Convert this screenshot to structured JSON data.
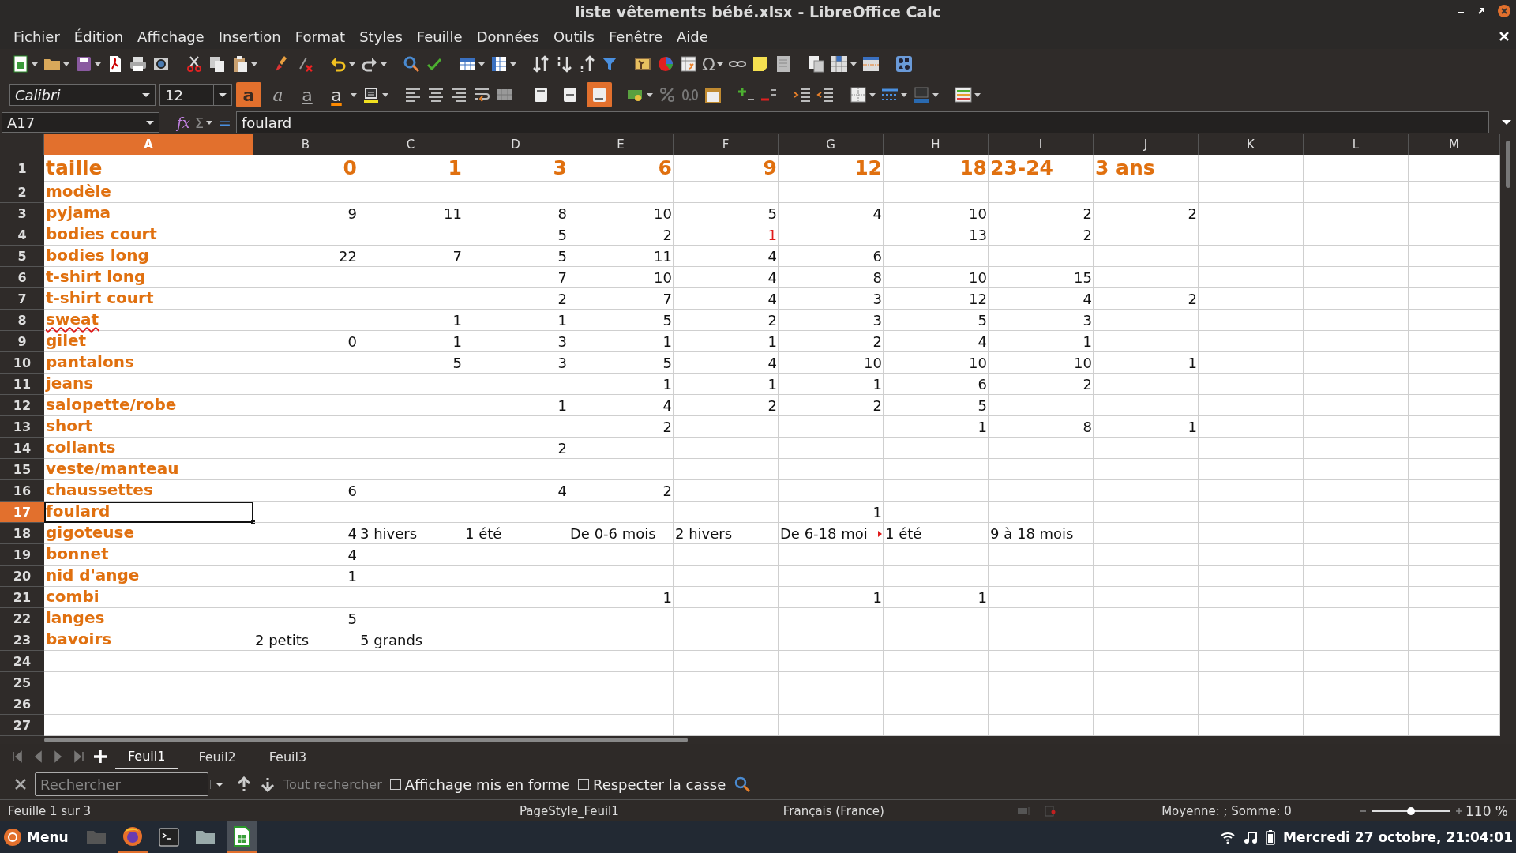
{
  "window": {
    "title": "liste vêtements bébé.xlsx - LibreOffice Calc"
  },
  "menu_bar": [
    "Fichier",
    "Édition",
    "Affichage",
    "Insertion",
    "Format",
    "Styles",
    "Feuille",
    "Données",
    "Outils",
    "Fenêtre",
    "Aide"
  ],
  "standard_toolbar": {
    "special_character_glyph": "Ω"
  },
  "formatting_toolbar": {
    "font_name": "Calibri",
    "font_size": "12",
    "text_buttons": [
      {
        "kind": "bold",
        "glyph": "a",
        "on": true
      },
      {
        "kind": "italic",
        "glyph": "a",
        "on": false
      },
      {
        "kind": "underline",
        "glyph": "a",
        "on": false
      },
      {
        "kind": "font_color",
        "glyph": "a",
        "on": false
      }
    ],
    "vertical_align": [
      {
        "kind": "top",
        "on": false
      },
      {
        "kind": "center",
        "on": false
      },
      {
        "kind": "bottom",
        "on": true
      }
    ]
  },
  "formula_bar": {
    "name_box": "A17",
    "wizard_glyph": "fx",
    "sum_glyph": "Σ",
    "equals_glyph": "=",
    "content": "foulard"
  },
  "sheet": {
    "columns": [
      {
        "label": "A",
        "selected": true
      },
      {
        "label": "B",
        "selected": false
      },
      {
        "label": "C",
        "selected": false
      },
      {
        "label": "D",
        "selected": false
      },
      {
        "label": "E",
        "selected": false
      },
      {
        "label": "F",
        "selected": false
      },
      {
        "label": "G",
        "selected": false
      },
      {
        "label": "H",
        "selected": false
      },
      {
        "label": "I",
        "selected": false
      },
      {
        "label": "J",
        "selected": false
      },
      {
        "label": "K",
        "selected": false
      },
      {
        "label": "L",
        "selected": false
      },
      {
        "label": "M",
        "selected": false
      }
    ],
    "rows": [
      {
        "label": "1",
        "selected": false,
        "kind": "heading",
        "cells": [
          {
            "text": "taille",
            "kind": "text"
          },
          {
            "text": "0",
            "kind": "number"
          },
          {
            "text": "1",
            "kind": "number"
          },
          {
            "text": "3",
            "kind": "number"
          },
          {
            "text": "6",
            "kind": "number"
          },
          {
            "text": "9",
            "kind": "number"
          },
          {
            "text": "12",
            "kind": "number"
          },
          {
            "text": "18",
            "kind": "number"
          },
          {
            "text": "23-24",
            "kind": "text"
          },
          {
            "text": "3 ans",
            "kind": "text"
          }
        ]
      },
      {
        "label": "2",
        "selected": false,
        "kind": "data",
        "cells": [
          {
            "text": "modèle",
            "kind": "text"
          }
        ]
      },
      {
        "label": "3",
        "selected": false,
        "kind": "data",
        "cells": [
          {
            "text": "pyjama",
            "kind": "text"
          },
          {
            "text": "9",
            "kind": "number"
          },
          {
            "text": "11",
            "kind": "number"
          },
          {
            "text": "8",
            "kind": "number"
          },
          {
            "text": "10",
            "kind": "number"
          },
          {
            "text": "5",
            "kind": "number"
          },
          {
            "text": "4",
            "kind": "number"
          },
          {
            "text": "10",
            "kind": "number"
          },
          {
            "text": "2",
            "kind": "number"
          },
          {
            "text": "2",
            "kind": "number"
          }
        ]
      },
      {
        "label": "4",
        "selected": false,
        "kind": "data",
        "cells": [
          {
            "text": "bodies court",
            "kind": "text"
          },
          null,
          null,
          {
            "text": "5",
            "kind": "number"
          },
          {
            "text": "2",
            "kind": "number"
          },
          {
            "text": "1",
            "kind": "number",
            "color": "#e01b1b"
          },
          null,
          {
            "text": "13",
            "kind": "number"
          },
          {
            "text": "2",
            "kind": "number"
          }
        ]
      },
      {
        "label": "5",
        "selected": false,
        "kind": "data",
        "cells": [
          {
            "text": "bodies long",
            "kind": "text"
          },
          {
            "text": "22",
            "kind": "number"
          },
          {
            "text": "7",
            "kind": "number"
          },
          {
            "text": "5",
            "kind": "number"
          },
          {
            "text": "11",
            "kind": "number"
          },
          {
            "text": "4",
            "kind": "number"
          },
          {
            "text": "6",
            "kind": "number"
          }
        ]
      },
      {
        "label": "6",
        "selected": false,
        "kind": "data",
        "cells": [
          {
            "text": "t-shirt long",
            "kind": "text"
          },
          null,
          null,
          {
            "text": "7",
            "kind": "number"
          },
          {
            "text": "10",
            "kind": "number"
          },
          {
            "text": "4",
            "kind": "number"
          },
          {
            "text": "8",
            "kind": "number"
          },
          {
            "text": "10",
            "kind": "number"
          },
          {
            "text": "15",
            "kind": "number"
          }
        ]
      },
      {
        "label": "7",
        "selected": false,
        "kind": "data",
        "cells": [
          {
            "text": "t-shirt court",
            "kind": "text"
          },
          null,
          null,
          {
            "text": "2",
            "kind": "number"
          },
          {
            "text": "7",
            "kind": "number"
          },
          {
            "text": "4",
            "kind": "number"
          },
          {
            "text": "3",
            "kind": "number"
          },
          {
            "text": "12",
            "kind": "number"
          },
          {
            "text": "4",
            "kind": "number"
          },
          {
            "text": "2",
            "kind": "number"
          }
        ]
      },
      {
        "label": "8",
        "selected": false,
        "kind": "data",
        "cells": [
          {
            "text": "sweat",
            "kind": "text",
            "misspelled": true
          },
          null,
          {
            "text": "1",
            "kind": "number"
          },
          {
            "text": "1",
            "kind": "number"
          },
          {
            "text": "5",
            "kind": "number"
          },
          {
            "text": "2",
            "kind": "number"
          },
          {
            "text": "3",
            "kind": "number"
          },
          {
            "text": "5",
            "kind": "number"
          },
          {
            "text": "3",
            "kind": "number"
          }
        ]
      },
      {
        "label": "9",
        "selected": false,
        "kind": "data",
        "cells": [
          {
            "text": "gilet",
            "kind": "text"
          },
          {
            "text": "0",
            "kind": "number"
          },
          {
            "text": "1",
            "kind": "number"
          },
          {
            "text": "3",
            "kind": "number"
          },
          {
            "text": "1",
            "kind": "number"
          },
          {
            "text": "1",
            "kind": "number"
          },
          {
            "text": "2",
            "kind": "number"
          },
          {
            "text": "4",
            "kind": "number"
          },
          {
            "text": "1",
            "kind": "number"
          }
        ]
      },
      {
        "label": "10",
        "selected": false,
        "kind": "data",
        "cells": [
          {
            "text": "pantalons",
            "kind": "text"
          },
          null,
          {
            "text": "5",
            "kind": "number"
          },
          {
            "text": "3",
            "kind": "number"
          },
          {
            "text": "5",
            "kind": "number"
          },
          {
            "text": "4",
            "kind": "number"
          },
          {
            "text": "10",
            "kind": "number"
          },
          {
            "text": "10",
            "kind": "number"
          },
          {
            "text": "10",
            "kind": "number"
          },
          {
            "text": "1",
            "kind": "number"
          }
        ]
      },
      {
        "label": "11",
        "selected": false,
        "kind": "data",
        "cells": [
          {
            "text": "jeans",
            "kind": "text"
          },
          null,
          null,
          null,
          {
            "text": "1",
            "kind": "number"
          },
          {
            "text": "1",
            "kind": "number"
          },
          {
            "text": "1",
            "kind": "number"
          },
          {
            "text": "6",
            "kind": "number"
          },
          {
            "text": "2",
            "kind": "number"
          }
        ]
      },
      {
        "label": "12",
        "selected": false,
        "kind": "data",
        "cells": [
          {
            "text": "salopette/robe",
            "kind": "text"
          },
          null,
          null,
          {
            "text": "1",
            "kind": "number"
          },
          {
            "text": "4",
            "kind": "number"
          },
          {
            "text": "2",
            "kind": "number"
          },
          {
            "text": "2",
            "kind": "number"
          },
          {
            "text": "5",
            "kind": "number"
          }
        ]
      },
      {
        "label": "13",
        "selected": false,
        "kind": "data",
        "cells": [
          {
            "text": "short",
            "kind": "text"
          },
          null,
          null,
          null,
          {
            "text": "2",
            "kind": "number"
          },
          null,
          null,
          {
            "text": "1",
            "kind": "number"
          },
          {
            "text": "8",
            "kind": "number"
          },
          {
            "text": "1",
            "kind": "number"
          }
        ]
      },
      {
        "label": "14",
        "selected": false,
        "kind": "data",
        "cells": [
          {
            "text": "collants",
            "kind": "text"
          },
          null,
          null,
          {
            "text": "2",
            "kind": "number"
          }
        ]
      },
      {
        "label": "15",
        "selected": false,
        "kind": "data",
        "cells": [
          {
            "text": "veste/manteau",
            "kind": "text"
          }
        ]
      },
      {
        "label": "16",
        "selected": false,
        "kind": "data",
        "cells": [
          {
            "text": "chaussettes",
            "kind": "text"
          },
          {
            "text": "6",
            "kind": "number"
          },
          null,
          {
            "text": "4",
            "kind": "number"
          },
          {
            "text": "2",
            "kind": "number"
          }
        ]
      },
      {
        "label": "17",
        "selected": true,
        "kind": "data",
        "cells": [
          {
            "text": "foulard",
            "kind": "text"
          },
          null,
          null,
          null,
          null,
          null,
          {
            "text": "1",
            "kind": "number"
          }
        ]
      },
      {
        "label": "18",
        "selected": false,
        "kind": "data",
        "cells": [
          {
            "text": "gigoteuse",
            "kind": "text"
          },
          {
            "text": "4",
            "kind": "number"
          },
          {
            "text": "3 hivers",
            "kind": "text"
          },
          {
            "text": "1 été",
            "kind": "text"
          },
          {
            "text": "De 0-6 mois",
            "kind": "text"
          },
          {
            "text": "2 hivers",
            "kind": "text"
          },
          {
            "text": "De 6-18 moi",
            "kind": "text",
            "overflow": true
          },
          {
            "text": "1 été",
            "kind": "text"
          },
          {
            "text": "9 à 18 mois",
            "kind": "text"
          }
        ]
      },
      {
        "label": "19",
        "selected": false,
        "kind": "data",
        "cells": [
          {
            "text": "bonnet",
            "kind": "text"
          },
          {
            "text": "4",
            "kind": "number"
          }
        ]
      },
      {
        "label": "20",
        "selected": false,
        "kind": "data",
        "cells": [
          {
            "text": "nid d'ange",
            "kind": "text"
          },
          {
            "text": "1",
            "kind": "number"
          }
        ]
      },
      {
        "label": "21",
        "selected": false,
        "kind": "data",
        "cells": [
          {
            "text": "combi",
            "kind": "text"
          },
          null,
          null,
          null,
          {
            "text": "1",
            "kind": "number"
          },
          null,
          {
            "text": "1",
            "kind": "number"
          },
          {
            "text": "1",
            "kind": "number"
          }
        ]
      },
      {
        "label": "22",
        "selected": false,
        "kind": "data",
        "cells": [
          {
            "text": "langes",
            "kind": "text"
          },
          {
            "text": "5",
            "kind": "number"
          }
        ]
      },
      {
        "label": "23",
        "selected": false,
        "kind": "data",
        "cells": [
          {
            "text": "bavoirs",
            "kind": "text"
          },
          {
            "text": "2 petits",
            "kind": "text"
          },
          {
            "text": "5 grands",
            "kind": "text"
          }
        ]
      },
      {
        "label": "24",
        "selected": false,
        "kind": "data",
        "cells": []
      },
      {
        "label": "25",
        "selected": false,
        "kind": "data",
        "cells": []
      },
      {
        "label": "26",
        "selected": false,
        "kind": "data",
        "cells": []
      },
      {
        "label": "27",
        "selected": false,
        "kind": "data",
        "cells": []
      }
    ]
  },
  "sheet_tabs": [
    {
      "label": "Feuil1",
      "selected": true
    },
    {
      "label": "Feuil2",
      "selected": false
    },
    {
      "label": "Feuil3",
      "selected": false
    }
  ],
  "find_bar": {
    "placeholder": "Rechercher",
    "find_all": "Tout rechercher",
    "options": [
      {
        "label": "Affichage mis en forme",
        "checked": false
      },
      {
        "label": "Respecter la casse",
        "checked": false
      }
    ]
  },
  "status_bar": {
    "sheet": "Feuille 1 sur 3",
    "page_style": "PageStyle_Feuil1",
    "language": "Français (France)",
    "summary": "Moyenne: ; Somme: 0",
    "zoom": {
      "level": 0.5
    },
    "zoom_text": "110 %"
  },
  "taskbar": {
    "menu": "Menu",
    "apps": [
      {
        "kind": "files",
        "running": false,
        "selected": false
      },
      {
        "kind": "browser",
        "running": true,
        "selected": false
      },
      {
        "kind": "terminal",
        "running": false,
        "selected": false
      },
      {
        "kind": "folder",
        "running": false,
        "selected": false
      },
      {
        "kind": "spreadsheet",
        "running": true,
        "selected": true
      }
    ],
    "clock": "Mercredi 27 octobre, 21:04:01"
  }
}
